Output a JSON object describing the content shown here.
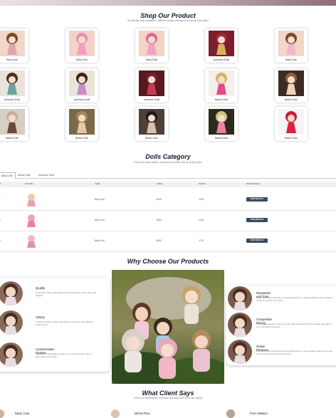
{
  "shop": {
    "title": "Shop Our Product",
    "subtitle": "All varieties dolls available in different shapes and types by special Doll maker",
    "products": [
      {
        "label": "Baby Dolls"
      },
      {
        "label": "Baby Dolls"
      },
      {
        "label": "Baby Dolls"
      },
      {
        "label": "American Dolls"
      },
      {
        "label": "Baby Dolls"
      },
      {
        "label": "American Dolls"
      },
      {
        "label": "American Dolls"
      },
      {
        "label": "American Dolls"
      },
      {
        "label": "Barbie Dolls"
      },
      {
        "label": "Barbie Dolls"
      },
      {
        "label": "Barbie Dolls"
      },
      {
        "label": "Barbie Dolls"
      },
      {
        "label": "Barbie Dolls"
      },
      {
        "label": "Barbie Dolls"
      },
      {
        "label": "Barbie Dolls"
      }
    ]
  },
  "category": {
    "title": "Dolls Category",
    "subtitle": "Check out about Barbie, American and Baby Doll by clicking Tabs",
    "tabs": [
      "Baby Dolls",
      "Barbie Dolls",
      "American Dolls"
    ],
    "columns": [
      "ID",
      "Picture",
      "Name",
      "Price",
      "Rating",
      "More Details"
    ],
    "rows": [
      {
        "id": "1",
        "name": "Baby Doll",
        "price": "$100",
        "rating": "4.8/5",
        "action": "VIEW DETAILS"
      },
      {
        "id": "2",
        "name": "Baby Doll",
        "price": "$300",
        "rating": "4.5/5",
        "action": "VIEW DETAILS"
      },
      {
        "id": "3",
        "name": "Baby Doll",
        "price": "$400",
        "rating": "4.7/5",
        "action": "VIEW DETAILS"
      }
    ]
  },
  "why": {
    "title": "Why Choose Our Products",
    "left": [
      {
        "title": "Quality",
        "desc": "Customers value high-quality products that are well-made and durable."
      },
      {
        "title": "Variety",
        "desc": "A diverse range of dolls can attract customers with different preferences."
      },
      {
        "title": "Customization Options",
        "desc": "Providing customization options to customers who want to personalize their dolls."
      }
    ],
    "right": [
      {
        "title": "Reputation and Trust",
        "desc": "If your doll shop has built a strong reputation for quality products and excellent customer service over time."
      },
      {
        "title": "Competitive Pricing",
        "desc": "Offering competitive prices for your dolls compared too the market can attract your potential customers."
      },
      {
        "title": "Online Presence",
        "desc": "Maintaining a robust presence through a blog or can engage customers sense of community around your doll shop."
      }
    ]
  },
  "clients": {
    "title": "What Client Says",
    "subtitle": "Check out what Barbie, American and Baby Doll Client are saying",
    "names": [
      "Daizy Cute",
      "Mickel Riva",
      "Ferin Watson"
    ]
  },
  "colors": {
    "accent": "#3d4a5c",
    "heading": "#141a2e"
  }
}
